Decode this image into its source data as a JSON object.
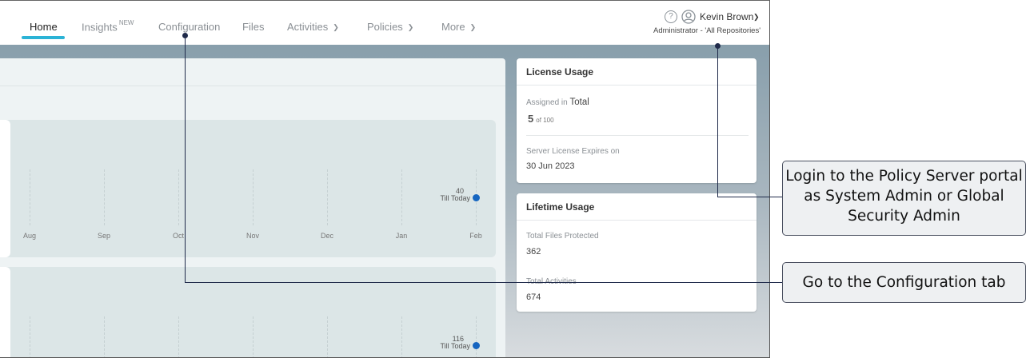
{
  "nav": {
    "tabs": [
      {
        "label": "Home",
        "badge": ""
      },
      {
        "label": "Insights",
        "badge": "NEW"
      },
      {
        "label": "Configuration",
        "badge": ""
      },
      {
        "label": "Files",
        "badge": ""
      },
      {
        "label": "Activities",
        "badge": ""
      },
      {
        "label": "Policies",
        "badge": ""
      },
      {
        "label": "More",
        "badge": ""
      }
    ],
    "active_tab": "Home"
  },
  "user": {
    "help_glyph": "?",
    "name": "Kevin Brown",
    "role": "Administrator - 'All Repositories'"
  },
  "charts": [
    {
      "x_ticks": [
        "Aug",
        "Sep",
        "Oct",
        "Nov",
        "Dec",
        "Jan",
        "Feb"
      ],
      "point_value": "40",
      "point_label": "Till Today"
    },
    {
      "point_value": "116",
      "point_label": "Till Today"
    }
  ],
  "license_usage": {
    "title": "License Usage",
    "assigned_label": "Assigned in",
    "assigned_scope": "Total",
    "assigned_count": "5",
    "assigned_total": "of 100",
    "expires_label": "Server License Expires on",
    "expires_value": "30 Jun 2023"
  },
  "lifetime_usage": {
    "title": "Lifetime Usage",
    "files_label": "Total Files Protected",
    "files_value": "362",
    "activities_label": "Total Activities",
    "activities_value": "674"
  },
  "callouts": {
    "login": "Login to the Policy Server portal as System Admin or Global Security Admin",
    "configuration": "Go to the Configuration tab"
  },
  "colors": {
    "accent": "#2bb3d6",
    "point": "#1565c0",
    "leader": "#1f2a4a"
  }
}
